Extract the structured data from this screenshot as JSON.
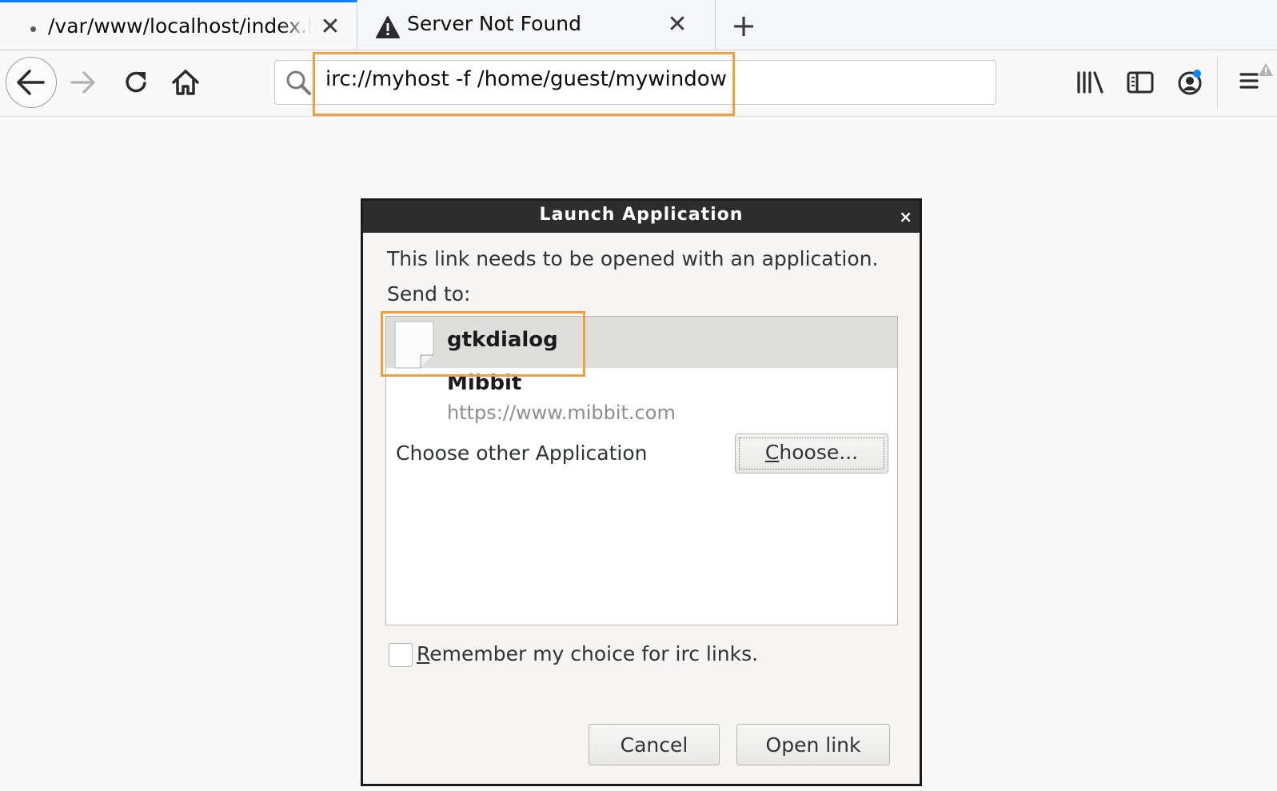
{
  "tabs": [
    {
      "title": "/var/www/localhost/index.html",
      "close": "✕"
    },
    {
      "title": "Server Not Found",
      "close": "✕"
    }
  ],
  "new_tab_label": "+",
  "url": "irc://myhost -f /home/guest/mywindow",
  "icons": {
    "back": "back-arrow-icon",
    "forward": "forward-arrow-icon",
    "reload": "reload-icon",
    "home": "home-icon",
    "search": "search-icon",
    "library": "library-icon",
    "sidebar": "sidebar-icon",
    "account": "account-icon",
    "menu": "hamburger-menu-icon",
    "warning": "warning-triangle-icon",
    "app": "generic-file-icon"
  },
  "dialog": {
    "title": "Launch Application",
    "close": "×",
    "message": "This link needs to be opened with an application.",
    "send_to": "Send to:",
    "apps": [
      {
        "name": "gtkdialog"
      },
      {
        "name": "Mibbit",
        "url": "https://www.mibbit.com"
      }
    ],
    "choose_other": "Choose other Application",
    "choose_button": {
      "mnemonic": "C",
      "rest": "hoose..."
    },
    "remember": {
      "mnemonic": "R",
      "rest": "emember my choice for irc links."
    },
    "remember_checked": false,
    "cancel": "Cancel",
    "open": "Open link"
  },
  "colors": {
    "highlight": "#f0a040",
    "active_tab": "#0a84ff",
    "titlebar": "#2d2d2d"
  }
}
